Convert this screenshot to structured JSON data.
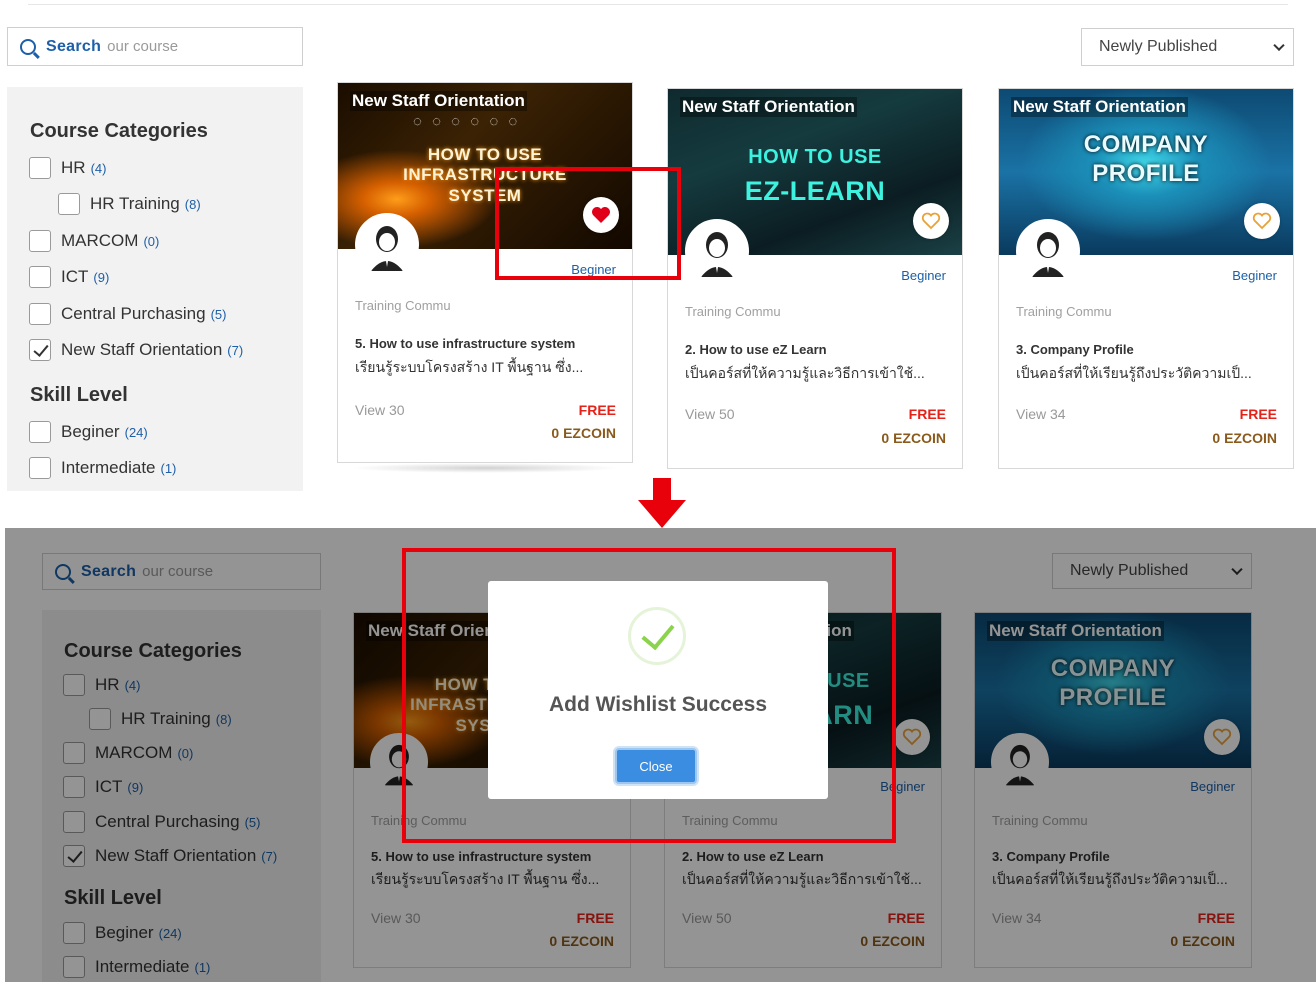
{
  "search": {
    "bold": "Search",
    "light": "our course"
  },
  "sort": {
    "selected": "Newly Published"
  },
  "sidebar": {
    "categories_heading": "Course Categories",
    "categories": [
      {
        "label": "HR",
        "count": "(4)",
        "checked": false
      },
      {
        "label": "HR Training",
        "count": "(8)",
        "checked": false
      },
      {
        "label": "MARCOM",
        "count": "(0)",
        "checked": false
      },
      {
        "label": "ICT",
        "count": "(9)",
        "checked": false
      },
      {
        "label": "Central Purchasing",
        "count": "(5)",
        "checked": false
      },
      {
        "label": "New Staff Orientation",
        "count": "(7)",
        "checked": true
      }
    ],
    "skill_heading": "Skill Level",
    "skills": [
      {
        "label": "Beginer",
        "count": "(24)"
      },
      {
        "label": "Intermediate",
        "count": "(1)"
      }
    ]
  },
  "cards": [
    {
      "thumb_title": "New Staff Orientation",
      "thumb_text_1": "HOW TO USE",
      "thumb_text_2": "INFRASTRUCTURE",
      "thumb_text_3": "SYSTEM",
      "level": "Beginer",
      "trainer": "Training Commu",
      "title": "5. How to use infrastructure system",
      "desc": "เรียนรู้ระบบโครงสร้าง IT พื้นฐาน ซึ่ง...",
      "views": "View 30",
      "price": "FREE",
      "coin": "0 EZCOIN",
      "wishlisted": true
    },
    {
      "thumb_title": "New Staff Orientation",
      "thumb_text_1": "HOW TO USE",
      "thumb_text_2": "EZ-LEARN",
      "level": "Beginer",
      "trainer": "Training Commu",
      "title": "2. How to use eZ Learn",
      "desc": "เป็นคอร์สที่ให้ความรู้และวิธีการเข้าใช้...",
      "views": "View 50",
      "price": "FREE",
      "coin": "0 EZCOIN",
      "wishlisted": false
    },
    {
      "thumb_title": "New Staff Orientation",
      "thumb_text_1": "COMPANY",
      "thumb_text_2": "PROFILE",
      "level": "Beginer",
      "trainer": "Training Commu",
      "title": "3. Company Profile",
      "desc": "เป็นคอร์สที่ให้เรียนรู้ถึงประวัติความเป็...",
      "views": "View 34",
      "price": "FREE",
      "coin": "0 EZCOIN",
      "wishlisted": false
    }
  ],
  "modal": {
    "title": "Add Wishlist Success",
    "close_label": "Close"
  },
  "colors": {
    "accent": "#1d5fa8",
    "free": "#e62117",
    "coin": "#8a5a1c",
    "highlight": "#e8000a",
    "success": "#8cd34d"
  },
  "icons": {
    "search": "search-icon",
    "heart_filled": "heart-filled-icon",
    "heart_outline": "heart-outline-icon",
    "arrow": "arrow-down-icon",
    "check": "check-icon"
  }
}
